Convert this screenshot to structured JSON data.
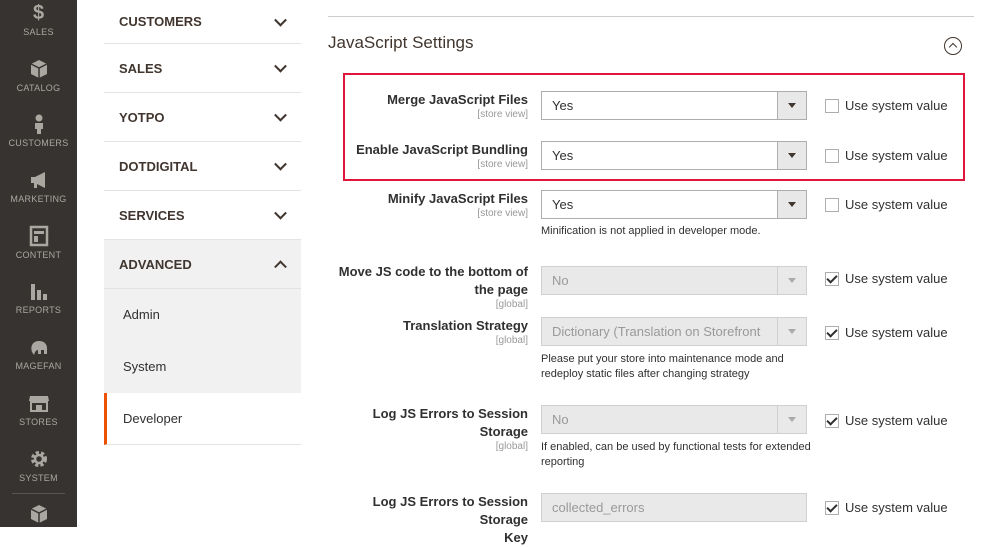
{
  "admin_nav": [
    {
      "label": "SALES",
      "icon": "dollar-icon"
    },
    {
      "label": "CATALOG",
      "icon": "box-icon"
    },
    {
      "label": "CUSTOMERS",
      "icon": "person-icon"
    },
    {
      "label": "MARKETING",
      "icon": "megaphone-icon"
    },
    {
      "label": "CONTENT",
      "icon": "layout-icon"
    },
    {
      "label": "REPORTS",
      "icon": "bar-chart-icon"
    },
    {
      "label": "MAGEFAN",
      "icon": "elephant-icon"
    },
    {
      "label": "STORES",
      "icon": "storefront-icon"
    },
    {
      "label": "SYSTEM",
      "icon": "gear-icon"
    }
  ],
  "tabs": {
    "groups": [
      "CUSTOMERS",
      "SALES",
      "YOTPO",
      "DOTDIGITAL",
      "SERVICES",
      "ADVANCED"
    ],
    "advanced_items": [
      "Admin",
      "System",
      "Developer"
    ]
  },
  "section": {
    "title": "JavaScript Settings"
  },
  "fields": [
    {
      "label": "Merge JavaScript Files",
      "scope": "[store view]",
      "value": "Yes",
      "note": "",
      "use_system": "Use system value",
      "checked": false
    },
    {
      "label": "Enable JavaScript Bundling",
      "scope": "[store view]",
      "value": "Yes",
      "note": "",
      "use_system": "Use system value",
      "checked": false
    },
    {
      "label": "Minify JavaScript Files",
      "scope": "[store view]",
      "value": "Yes",
      "note": "Minification is not applied in developer mode.",
      "use_system": "Use system value",
      "checked": false
    },
    {
      "label_line1": "Move JS code to the bottom of",
      "label_line2": "the page",
      "scope": "[global]",
      "value": "No",
      "note": "",
      "use_system": "Use system value",
      "checked": true
    },
    {
      "label": "Translation Strategy",
      "scope": "[global]",
      "value": "Dictionary (Translation on Storefront",
      "note": "Please put your store into maintenance mode and redeploy static files after changing strategy",
      "use_system": "Use system value",
      "checked": true
    },
    {
      "label": "Log JS Errors to Session Storage",
      "scope": "[global]",
      "value": "No",
      "note": "If enabled, can be used by functional tests for extended reporting",
      "use_system": "Use system value",
      "checked": true
    },
    {
      "label_line1": "Log JS Errors to Session Storage",
      "label_line2": "Key",
      "scope": "",
      "value": "collected_errors",
      "note": "",
      "use_system": "Use system value",
      "checked": true
    }
  ],
  "colors": {
    "highlight": "#e2163d",
    "active_tab_accent": "#eb5202",
    "admin_nav_bg": "#373330"
  }
}
